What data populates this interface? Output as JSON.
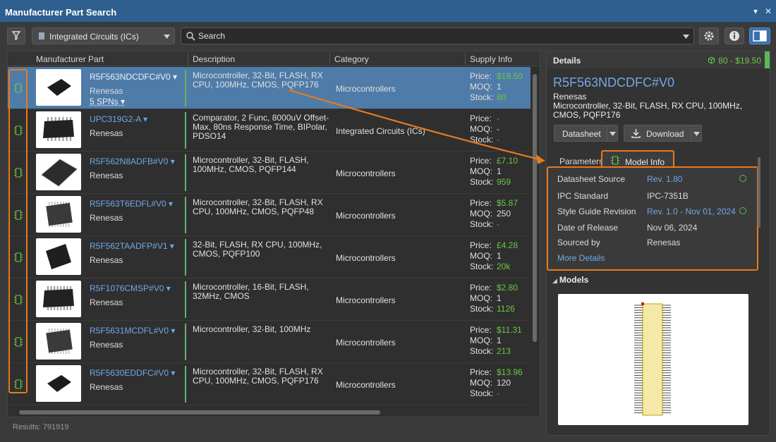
{
  "window": {
    "title": "Manufacturer Part Search",
    "menu_glyph": "▾",
    "close_glyph": "✕"
  },
  "toolbar": {
    "category": "Integrated Circuits (ICs)",
    "search_placeholder": "Search"
  },
  "grid": {
    "columns": [
      "Manufacturer Part",
      "Description",
      "Category",
      "Supply Info"
    ],
    "supply_labels": {
      "price": "Price:",
      "moq": "MOQ:",
      "stock": "Stock:"
    },
    "rows": [
      {
        "mpn": "R5F563NDCDFC#V0",
        "mfr": "Renesas",
        "spns": "5 SPNs",
        "desc": "Microcontroller, 32-Bit, FLASH, RX CPU, 100MHz, CMOS, PQFP176",
        "category": "Microcontrollers",
        "price": "$19.50",
        "moq": "1",
        "stock": "80",
        "selected": true,
        "pkg": "qfp-small"
      },
      {
        "mpn": "UPC319G2-A",
        "mfr": "Renesas",
        "spns": "",
        "desc": "Comparator, 2 Func, 8000uV Offset-Max, 80ns Response Time, BIPolar, PDSO14",
        "category": "Integrated Circuits (ICs)",
        "price": "-",
        "moq": "-",
        "stock": "-",
        "selected": false,
        "pkg": "soic"
      },
      {
        "mpn": "R5F562N8ADFB#V0",
        "mfr": "Renesas",
        "spns": "",
        "desc": "Microcontroller, 32-Bit, FLASH, 100MHz, CMOS, PQFP144",
        "category": "Microcontrollers",
        "price": "£7.10",
        "moq": "1",
        "stock": "959",
        "selected": false,
        "pkg": "qfp-large"
      },
      {
        "mpn": "R5F563T6EDFL#V0",
        "mfr": "Renesas",
        "spns": "",
        "desc": "Microcontroller, 32-Bit, FLASH, RX CPU, 100MHz, CMOS, PQFP48",
        "category": "Microcontrollers",
        "price": "$5.87",
        "moq": "250",
        "stock": "-",
        "selected": false,
        "pkg": "qfp-pins"
      },
      {
        "mpn": "R5F562TAADFP#V1",
        "mfr": "Renesas",
        "spns": "",
        "desc": "32-Bit, FLASH, RX CPU, 100MHz, CMOS, PQFP100",
        "category": "Microcontrollers",
        "price": "£4.28",
        "moq": "1",
        "stock": "20k",
        "selected": false,
        "pkg": "qfp-tilt"
      },
      {
        "mpn": "R5F1076CMSP#V0",
        "mfr": "Renesas",
        "spns": "",
        "desc": "Microcontroller, 16-Bit, FLASH, 32MHz, CMOS",
        "category": "Microcontrollers",
        "price": "$2.80",
        "moq": "1",
        "stock": "1126",
        "selected": false,
        "pkg": "ssop"
      },
      {
        "mpn": "R5F5631MCDFL#V0",
        "mfr": "Renesas",
        "spns": "",
        "desc": "Microcontroller, 32-Bit, 100MHz",
        "category": "Microcontrollers",
        "price": "$11.31",
        "moq": "1",
        "stock": "213",
        "selected": false,
        "pkg": "qfp-pins"
      },
      {
        "mpn": "R5F5630EDDFC#V0",
        "mfr": "Renesas",
        "spns": "",
        "desc": "Microcontroller, 32-Bit, FLASH, RX CPU, 100MHz, CMOS, PQFP176",
        "category": "Microcontrollers",
        "price": "$13.96",
        "moq": "120",
        "stock": "-",
        "selected": false,
        "pkg": "qfp-small"
      }
    ]
  },
  "status": {
    "results": "Results: 791919"
  },
  "details": {
    "header": "Details",
    "stock_summary": "80 - $19.50",
    "part": "R5F563NDCDFC#V0",
    "manufacturer": "Renesas",
    "description": "Microcontroller, 32-Bit, FLASH, RX CPU, 100MHz, CMOS, PQFP176",
    "datasheet_label": "Datasheet",
    "download_label": "Download",
    "tabs": {
      "parameters": "Parameters",
      "model_info": "Model Info"
    },
    "model_info": [
      {
        "key": "Datasheet Source",
        "value": "Rev. 1.80",
        "link": true,
        "ok": true
      },
      {
        "key": "IPC Standard",
        "value": "IPC-7351B",
        "link": false,
        "ok": false
      },
      {
        "key": "Style Guide Revision",
        "value": "Rev. 1.0 - Nov 01, 2024",
        "link": true,
        "ok": true
      },
      {
        "key": "Date of Release",
        "value": "Nov 06, 2024",
        "link": false,
        "ok": false
      },
      {
        "key": "Sourced by",
        "value": "Renesas",
        "link": false,
        "ok": false
      }
    ],
    "more_details": "More Details",
    "models_header": "Models"
  },
  "colors": {
    "accent": "#e87a1d",
    "link": "#6fa9e6",
    "positive": "#6cc644",
    "negative": "#e05050",
    "selection": "#4f7ba8"
  }
}
